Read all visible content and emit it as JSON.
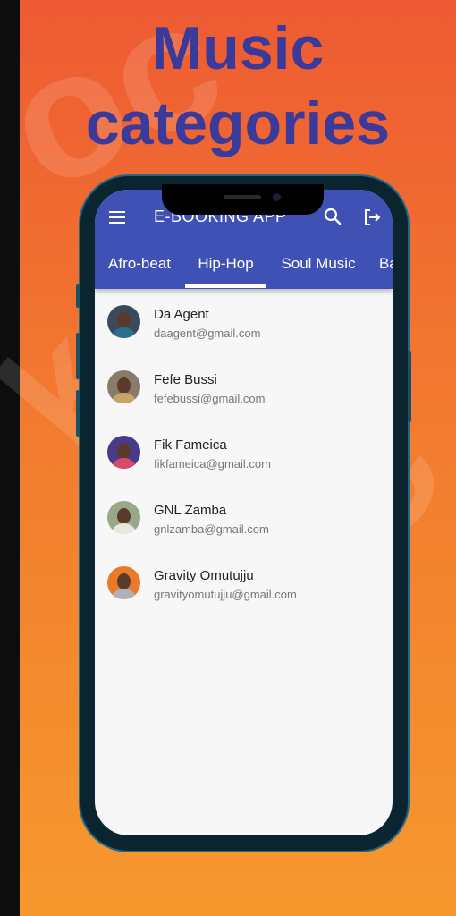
{
  "headline": {
    "line1": "Music",
    "line2": "categories"
  },
  "app": {
    "title": "E-BOOKING APP"
  },
  "tabs": [
    {
      "label": "Afro-beat"
    },
    {
      "label": "Hip-Hop"
    },
    {
      "label": "Soul Music"
    },
    {
      "label": "Ba"
    }
  ],
  "selected_tab": "Hip-Hop",
  "artists": [
    {
      "name": "Da Agent",
      "email": "daagent@gmail.com"
    },
    {
      "name": "Fefe Bussi",
      "email": "fefebussi@gmail.com"
    },
    {
      "name": "Fik Fameica",
      "email": "fikfameica@gmail.com"
    },
    {
      "name": "GNL Zamba",
      "email": "gnlzamba@gmail.com"
    },
    {
      "name": "Gravity Omutujju",
      "email": "gravityomutujju@gmail.com"
    }
  ],
  "icons": {
    "menu": "menu-icon",
    "search": "search-icon",
    "logout": "logout-icon"
  },
  "colors": {
    "appbar": "#3f51b5",
    "headline": "#3a3a9a",
    "background_top": "#ee5a33",
    "background_bottom": "#f6982e"
  }
}
